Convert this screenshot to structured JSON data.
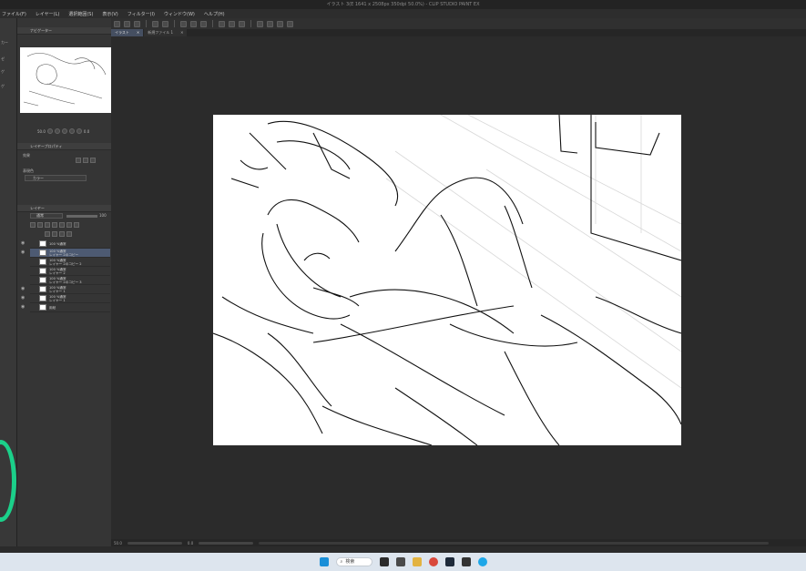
{
  "window": {
    "title": "イラスト 3(E 1641 x 2508px 350dpi 50.0%) - CLIP STUDIO PAINT EX"
  },
  "menu": [
    "ファイル(F)",
    "レイヤー(L)",
    "選択範囲(S)",
    "表示(V)",
    "フィルター(I)",
    "ウィンドウ(W)",
    "ヘルプ(H)"
  ],
  "left_strip_labels": [
    "カー",
    "ゼ",
    "ゲ",
    "ゲ"
  ],
  "panels": {
    "navigator_tab": "ナビゲーター",
    "navigator_zoom": "50.0",
    "navigator_angle": "0.0",
    "layer_property_tab": "レイヤープロパティ",
    "effect_label": "効果",
    "expression_color_label": "表現色",
    "expression_color_value": "カラー",
    "layer_tab": "レイヤー",
    "blend_mode": "通常",
    "opacity": "100"
  },
  "layers": [
    {
      "name": "100 %通常",
      "sub": "",
      "selected": false,
      "visible": true
    },
    {
      "name": "100 %通常",
      "sub": "レイヤー 2のコピー",
      "selected": true,
      "visible": true
    },
    {
      "name": "100 %通常",
      "sub": "レイヤー 2のコピー 2",
      "selected": false,
      "visible": false
    },
    {
      "name": "100 %通常",
      "sub": "レイヤー 2",
      "selected": false,
      "visible": false
    },
    {
      "name": "100 %通常",
      "sub": "レイヤー 2のコピー 3",
      "selected": false,
      "visible": false
    },
    {
      "name": "100 %通常",
      "sub": "レイヤー 1",
      "selected": false,
      "visible": true
    },
    {
      "name": "100 %通常",
      "sub": "レイヤー 1",
      "selected": false,
      "visible": true
    },
    {
      "name": "用紙",
      "sub": "",
      "selected": false,
      "visible": true
    }
  ],
  "tabs": [
    {
      "label": "イラスト",
      "active": true
    },
    {
      "label": "新規ファイル 1",
      "active": false
    }
  ],
  "status": {
    "zoom": "50.0",
    "angle": "0.0"
  },
  "taskbar": {
    "search_label": "検索"
  },
  "colors": {
    "accent": "#4d5a72",
    "ring": "#1bd08a"
  }
}
